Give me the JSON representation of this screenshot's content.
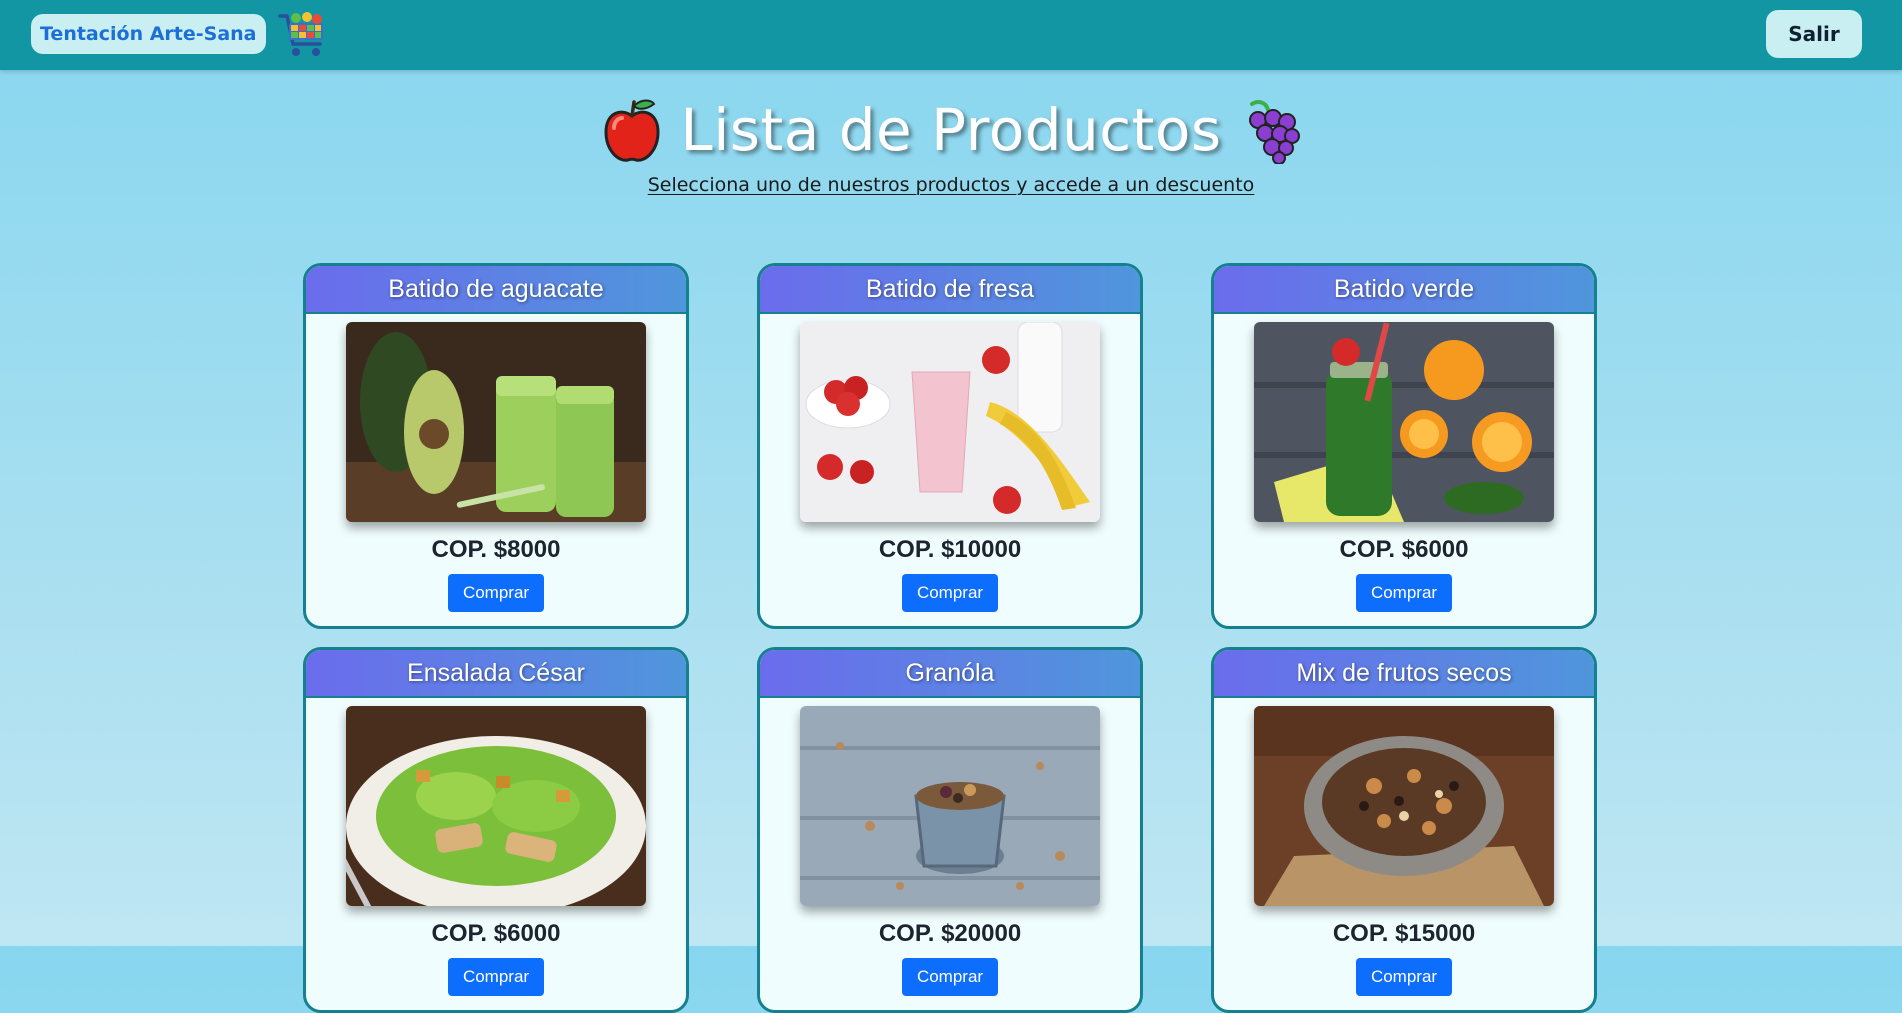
{
  "navbar": {
    "brand": "Tentación Arte-Sana",
    "cart_icon": "shopping-cart-icon",
    "logout_label": "Salir"
  },
  "header": {
    "title": "Lista de Productos",
    "left_icon": "apple-icon",
    "right_icon": "grapes-icon",
    "subtitle": "Selecciona uno de nuestros productos y accede a un descuento"
  },
  "products": [
    {
      "name": "Batido de aguacate",
      "price": "COP. $8000",
      "button": "Comprar"
    },
    {
      "name": "Batido de fresa",
      "price": "COP. $10000",
      "button": "Comprar"
    },
    {
      "name": "Batido verde",
      "price": "COP. $6000",
      "button": "Comprar"
    },
    {
      "name": "Ensalada César",
      "price": "COP. $6000",
      "button": "Comprar"
    },
    {
      "name": "Granóla",
      "price": "COP. $20000",
      "button": "Comprar"
    },
    {
      "name": "Mix de frutos secos",
      "price": "COP. $15000",
      "button": "Comprar"
    }
  ],
  "colors": {
    "navbar": "#1296a4",
    "card_header_start": "#6b6cec",
    "card_header_end": "#4f96dc",
    "card_border": "#15818f",
    "buy_button": "#0d6efd"
  }
}
